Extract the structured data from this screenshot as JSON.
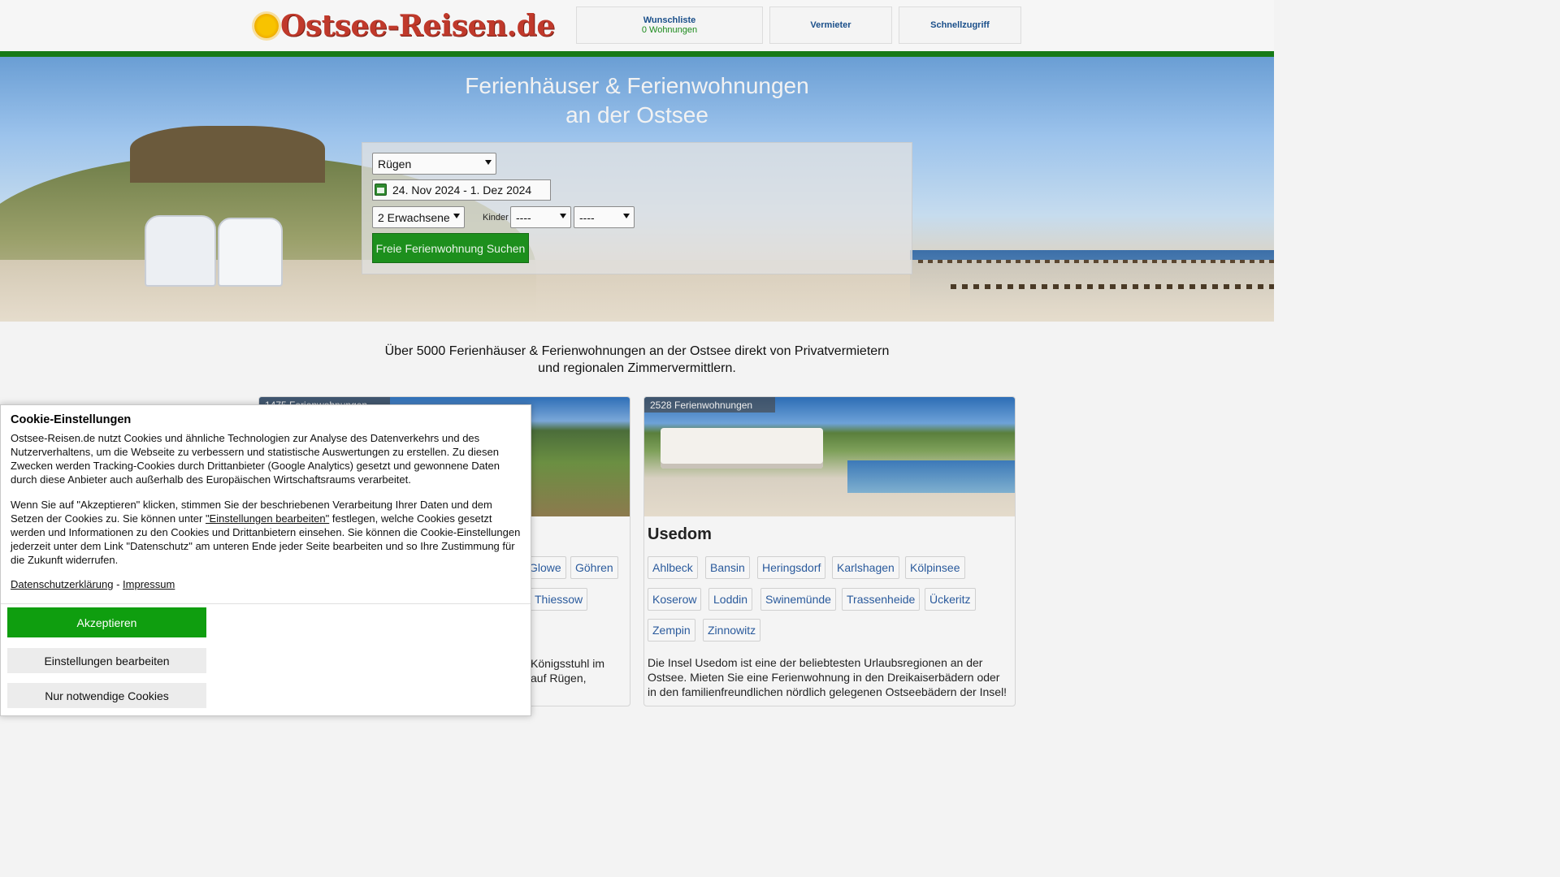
{
  "header": {
    "logo_text": "Ostsee-Reisen.de",
    "wishlist_label": "Wunschliste",
    "wishlist_count": "0 Wohnungen",
    "vermieter_label": "Vermieter",
    "schnellzugriff_label": "Schnellzugriff"
  },
  "hero": {
    "title_line1": "Ferienhäuser & Ferienwohnungen",
    "title_line2": "an der Ostsee"
  },
  "search": {
    "region_selected": "Rügen",
    "date_range": "24. Nov 2024 - 1. Dez 2024",
    "adults_selected": "2 Erwachsene",
    "kinder_label": "Kinder",
    "child1_selected": "----",
    "child2_selected": "----",
    "submit_label": "Freie Ferienwohnung Suchen"
  },
  "intro": {
    "line1": "Über 5000 Ferienhäuser & Ferienwohnungen an der Ostsee direkt von Privatvermietern",
    "line2": "und regionalen Zimmervermittlern."
  },
  "regions": [
    {
      "count": "1475 Ferienwohnungen",
      "visible_tags": [
        "Glowe",
        "Göhren",
        "Thiessow"
      ],
      "desc_fragment1": "Königsstuhl im",
      "desc_fragment2": "auf Rügen,"
    },
    {
      "count": "2528 Ferienwohnungen",
      "name": "Usedom",
      "tags": [
        "Ahlbeck",
        "Bansin",
        "Heringsdorf",
        "Karlshagen",
        "Kölpinsee",
        "Koserow",
        "Loddin",
        "Swinemünde",
        "Trassenheide",
        "Ückeritz",
        "Zempin",
        "Zinnowitz"
      ],
      "description": "Die Insel Usedom ist eine der beliebtesten Urlaubsregionen an der Ostsee. Mieten Sie eine Ferienwohnung in den Dreikaiserbädern oder in den familienfreundlichen nördlich gelegenen Ostseebädern der Insel!"
    }
  ],
  "cookie": {
    "title": "Cookie-Einstellungen",
    "p1": "Ostsee-Reisen.de nutzt Cookies und ähnliche Technologien zur Analyse des Datenverkehrs und des Nutzerverhaltens, um die Webseite zu verbessern und statistische Auswertungen zu erstellen. Zu diesen Zwecken werden Tracking-Cookies durch Drittanbieter (Google Analytics) gesetzt und gewonnene Daten durch diese Anbieter auch außerhalb des Europäischen Wirtschaftsraums verarbeitet.",
    "p2_before": "Wenn Sie auf \"Akzeptieren\" klicken, stimmen Sie der beschriebenen Verarbeitung Ihrer Daten und dem Setzen der Cookies zu. Sie können unter ",
    "p2_link": "\"Einstellungen bearbeiten\"",
    "p2_after": " festlegen, welche Cookies gesetzt werden und Informationen zu den Cookies und Drittanbietern einsehen. Sie können die Cookie-Einstellungen jederzeit unter dem Link \"Datenschutz\" am unteren Ende jeder Seite bearbeiten und so Ihre Zustimmung für die Zukunft widerrufen.",
    "privacy_link": "Datenschutzerklärung",
    "link_separator": " - ",
    "imprint_link": "Impressum",
    "accept_label": "Akzeptieren",
    "edit_label": "Einstellungen bearbeiten",
    "necessary_label": "Nur notwendige Cookies"
  },
  "colors": {
    "brand_green": "#177a17",
    "button_green": "#1d8f1d",
    "accept_green": "#0f9e0f",
    "link_blue": "#2a5a9c",
    "logo_red": "#c0392b"
  }
}
